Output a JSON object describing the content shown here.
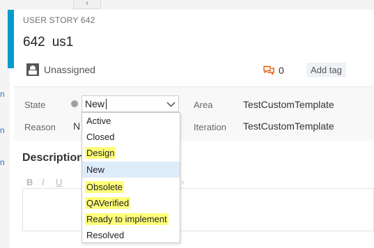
{
  "header": {
    "item_type": "USER STORY 642",
    "id": "642",
    "title": "us1",
    "assignee": "Unassigned",
    "comment_count": "0",
    "add_tag": "Add tag"
  },
  "nav": {
    "collapse_glyph": "‹"
  },
  "fields": {
    "state_label": "State",
    "state_value": "New",
    "reason_label": "Reason",
    "reason_value": "N",
    "area_label": "Area",
    "area_value": "TestCustomTemplate",
    "iteration_label": "Iteration",
    "iteration_value": "TestCustomTemplate"
  },
  "description": {
    "title": "Description",
    "toolbar": [
      "B",
      "I",
      "U"
    ]
  },
  "state_options": [
    "Active",
    "Closed",
    "Design",
    "New",
    "Obsolete",
    "QAVerified",
    "Ready to implement",
    "Resolved"
  ],
  "colors": {
    "accent": "#009ccc",
    "highlight": "#ffff7a",
    "selected_option": "#deebf9",
    "comment_icon": "#e8590c"
  }
}
